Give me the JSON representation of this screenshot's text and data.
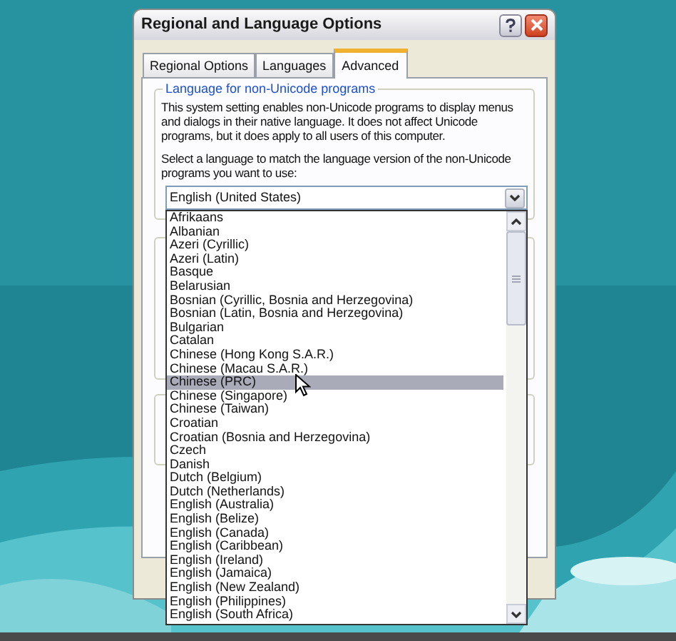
{
  "window": {
    "title": "Regional and Language Options"
  },
  "tabs": [
    {
      "label": "Regional Options",
      "selected": false
    },
    {
      "label": "Languages",
      "selected": false
    },
    {
      "label": "Advanced",
      "selected": true
    }
  ],
  "group": {
    "title": "Language for non-Unicode programs",
    "description": "This system setting enables non-Unicode programs to display menus and dialogs in their native language. It does not affect Unicode programs, but it does apply to all users of this computer.",
    "prompt": "Select a language to match the language version of the non-Unicode programs you want to use:"
  },
  "dropdown": {
    "value": "English (United States)",
    "expanded": true
  },
  "options": [
    {
      "label": "Afrikaans",
      "selected": false
    },
    {
      "label": "Albanian",
      "selected": false
    },
    {
      "label": "Azeri (Cyrillic)",
      "selected": false
    },
    {
      "label": "Azeri (Latin)",
      "selected": false
    },
    {
      "label": "Basque",
      "selected": false
    },
    {
      "label": "Belarusian",
      "selected": false
    },
    {
      "label": "Bosnian (Cyrillic, Bosnia and Herzegovina)",
      "selected": false
    },
    {
      "label": "Bosnian (Latin, Bosnia and Herzegovina)",
      "selected": false
    },
    {
      "label": "Bulgarian",
      "selected": false
    },
    {
      "label": "Catalan",
      "selected": false
    },
    {
      "label": "Chinese (Hong Kong S.A.R.)",
      "selected": false
    },
    {
      "label": "Chinese (Macau S.A.R.)",
      "selected": false
    },
    {
      "label": "Chinese (PRC)",
      "selected": true
    },
    {
      "label": "Chinese (Singapore)",
      "selected": false
    },
    {
      "label": "Chinese (Taiwan)",
      "selected": false
    },
    {
      "label": "Croatian",
      "selected": false
    },
    {
      "label": "Croatian (Bosnia and Herzegovina)",
      "selected": false
    },
    {
      "label": "Czech",
      "selected": false
    },
    {
      "label": "Danish",
      "selected": false
    },
    {
      "label": "Dutch (Belgium)",
      "selected": false
    },
    {
      "label": "Dutch (Netherlands)",
      "selected": false
    },
    {
      "label": "English (Australia)",
      "selected": false
    },
    {
      "label": "English (Belize)",
      "selected": false
    },
    {
      "label": "English (Canada)",
      "selected": false
    },
    {
      "label": "English (Caribbean)",
      "selected": false
    },
    {
      "label": "English (Ireland)",
      "selected": false
    },
    {
      "label": "English (Jamaica)",
      "selected": false
    },
    {
      "label": "English (New Zealand)",
      "selected": false
    },
    {
      "label": "English (Philippines)",
      "selected": false
    },
    {
      "label": "English (South Africa)",
      "selected": false
    }
  ]
}
